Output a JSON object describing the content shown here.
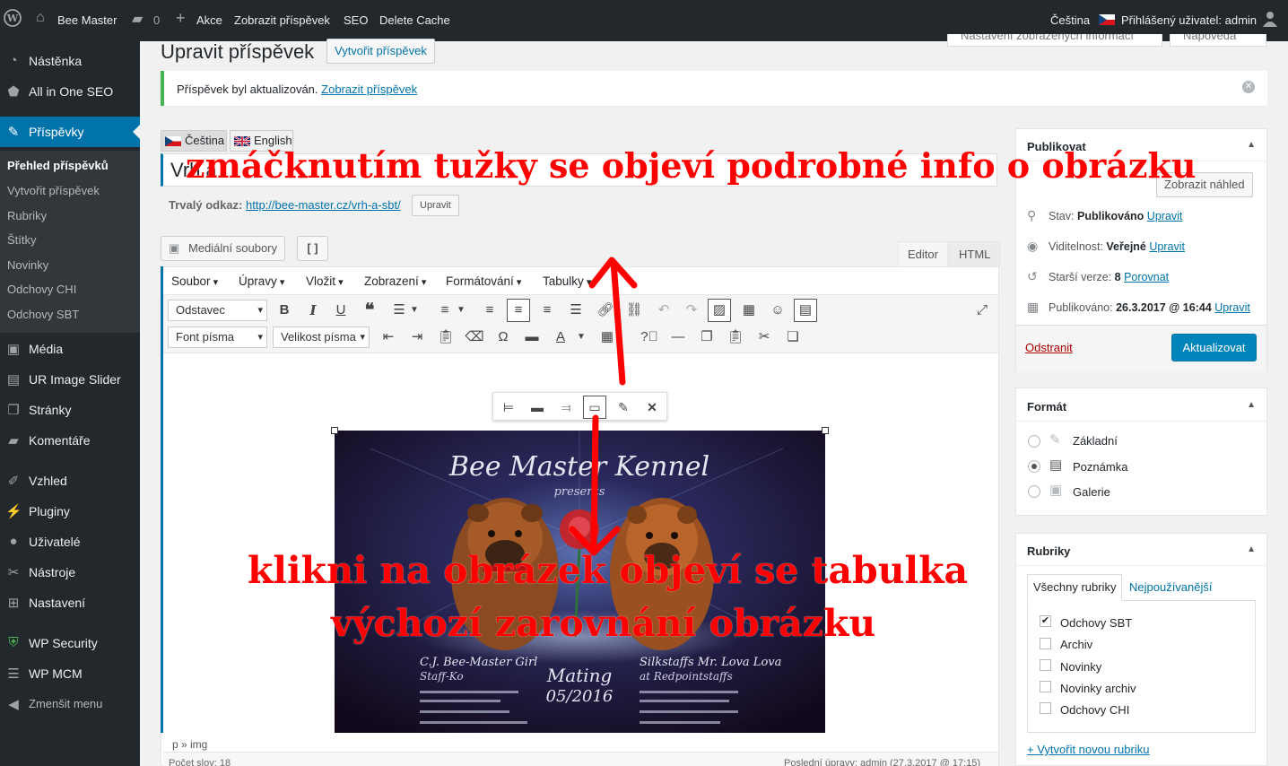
{
  "adminbar": {
    "site_name": "Bee Master",
    "comments_count": "0",
    "new_label": "Akce",
    "view_post": "Zobrazit příspěvek",
    "seo": "SEO",
    "delete_cache": "Delete Cache",
    "language": "Čeština",
    "logged_user": "Přihlášený uživatel: admin"
  },
  "sidebar": {
    "items": [
      {
        "label": "Nástěnka",
        "icon": "dashboard-icon"
      },
      {
        "label": "All in One SEO",
        "icon": "seo-icon"
      },
      {
        "label": "Příspěvky",
        "icon": "pin-icon"
      },
      {
        "label": "Média",
        "icon": "media-icon"
      },
      {
        "label": "UR Image Slider",
        "icon": "slider-icon"
      },
      {
        "label": "Stránky",
        "icon": "pages-icon"
      },
      {
        "label": "Komentáře",
        "icon": "comments-icon"
      },
      {
        "label": "Vzhled",
        "icon": "appearance-icon"
      },
      {
        "label": "Pluginy",
        "icon": "plugins-icon"
      },
      {
        "label": "Uživatelé",
        "icon": "users-icon"
      },
      {
        "label": "Nástroje",
        "icon": "tools-icon"
      },
      {
        "label": "Nastavení",
        "icon": "settings-icon"
      },
      {
        "label": "WP Security",
        "icon": "shield-icon"
      },
      {
        "label": "WP MCM",
        "icon": "mcm-icon"
      },
      {
        "label": "Zmenšit menu",
        "icon": "collapse-icon"
      }
    ],
    "submenu": [
      "Přehled příspěvků",
      "Vytvořit příspěvek",
      "Rubriky",
      "Štítky",
      "Novinky",
      "Odchovy CHI",
      "Odchovy SBT"
    ]
  },
  "screen_options": {
    "options": "Nastavení zobrazených informací",
    "help": "Nápověda"
  },
  "page": {
    "title": "Upravit příspěvek",
    "add_new": "Vytvořit příspěvek",
    "notice_text": "Příspěvek byl aktualizován.",
    "notice_link": "Zobrazit příspěvek"
  },
  "lang_tabs": [
    "Čeština",
    "English"
  ],
  "post": {
    "title": "Vrh a",
    "permalink_label": "Trvalý odkaz:",
    "permalink_url": "http://bee-master.cz/vrh-a-sbt/",
    "edit_permalink": "Upravit"
  },
  "editor": {
    "media_button": "Mediální soubory",
    "shortcode_button": "[ ]",
    "tab_visual": "Editor",
    "tab_html": "HTML",
    "menubar": [
      "Soubor",
      "Úpravy",
      "Vložit",
      "Zobrazení",
      "Formátování",
      "Tabulky"
    ],
    "format_select": "Odstavec",
    "font_select": "Font písma",
    "size_select": "Velikost písma",
    "path": "p » img",
    "word_count": "Počet slov: 18",
    "last_edit": "Poslední úpravy: admin (27.3.2017 @ 17:15)"
  },
  "image_text": {
    "kennel": "Bee Master Kennel",
    "presents": "presents",
    "sire_name": "C.J. Bee-Master Girl",
    "sire_sub": "Staff-Ko",
    "dam_name": "Silkstaffs Mr. Lova Lova",
    "dam_sub": "at Redpointstaffs",
    "mating": "Mating",
    "date": "05/2016"
  },
  "publish": {
    "title": "Publikovat",
    "preview": "Zobrazit náhled",
    "status_label": "Stav:",
    "status_value": "Publikováno",
    "visibility_label": "Viditelnost:",
    "visibility_value": "Veřejné",
    "revisions_label": "Starší verze:",
    "revisions_value": "8",
    "revisions_link": "Porovnat",
    "published_label": "Publikováno:",
    "published_value": "26.3.2017 @ 16:44",
    "edit": "Upravit",
    "trash": "Odstranit",
    "update": "Aktualizovat"
  },
  "format": {
    "title": "Formát",
    "options": [
      {
        "label": "Základní",
        "checked": false
      },
      {
        "label": "Poznámka",
        "checked": true
      },
      {
        "label": "Galerie",
        "checked": false
      }
    ]
  },
  "categories": {
    "title": "Rubriky",
    "tab_all": "Všechny rubriky",
    "tab_popular": "Nejpoužívanější",
    "items": [
      {
        "label": "Odchovy SBT",
        "checked": true
      },
      {
        "label": "Archiv",
        "checked": false
      },
      {
        "label": "Novinky",
        "checked": false
      },
      {
        "label": "Novinky archiv",
        "checked": false
      },
      {
        "label": "Odchovy CHI",
        "checked": false
      }
    ],
    "add_new": "+ Vytvořit novou rubriku"
  },
  "annotations": {
    "top": "zmáčknutím tužky se objeví podrobné info o obrázku",
    "bottom_line1": "klikni na obrázek objeví se tabulka",
    "bottom_line2": "výchozí zarovnání obrázku"
  },
  "colors": {
    "accent": "#0073aa",
    "annotation": "#ff0000",
    "adminbar": "#23282d",
    "update_button": "#0085ba"
  }
}
